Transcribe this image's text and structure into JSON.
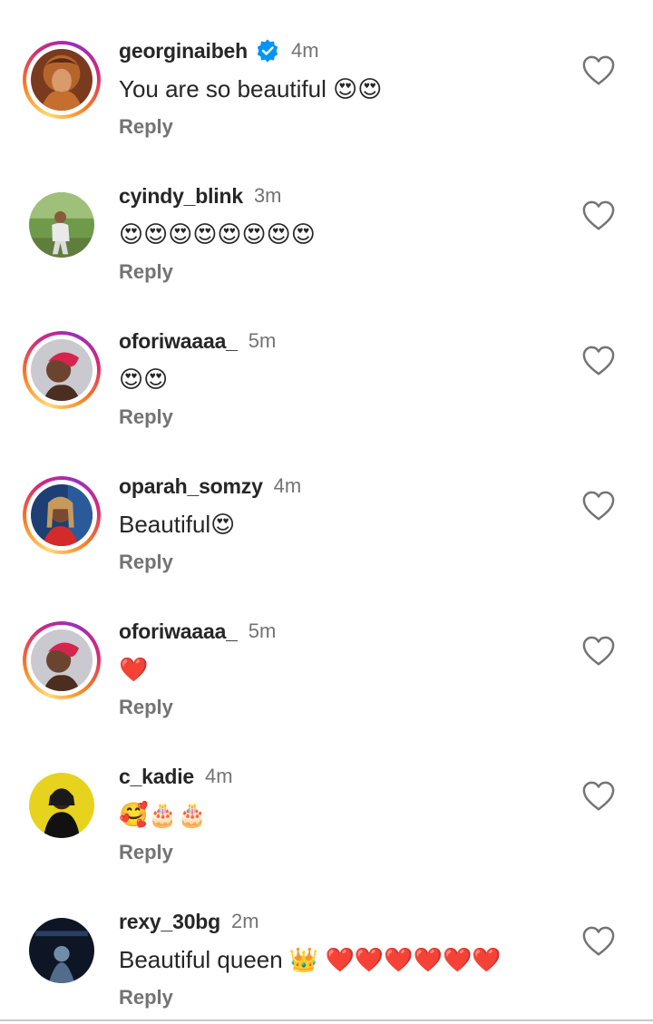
{
  "reply_label": "Reply",
  "colors": {
    "username": "#262626",
    "meta": "#737373",
    "verified": "#0095f6",
    "ring_gradient": [
      "#feda75",
      "#fa7e1e",
      "#d62976",
      "#962fbf"
    ]
  },
  "comments": [
    {
      "username": "georginaibeh",
      "verified": true,
      "time": "4m",
      "text": "You are so beautiful 😍😍",
      "story_ring": true,
      "liked": false
    },
    {
      "username": "cyindy_blink",
      "verified": false,
      "time": "3m",
      "text": "😍😍😍😍😍😍😍😍",
      "story_ring": false,
      "liked": false
    },
    {
      "username": "oforiwaaaa_",
      "verified": false,
      "time": "5m",
      "text": "😍😍",
      "story_ring": true,
      "liked": false
    },
    {
      "username": "oparah_somzy",
      "verified": false,
      "time": "4m",
      "text": "Beautiful😍",
      "story_ring": true,
      "liked": false
    },
    {
      "username": "oforiwaaaa_",
      "verified": false,
      "time": "5m",
      "text": "❤️",
      "story_ring": true,
      "liked": false
    },
    {
      "username": "c_kadie",
      "verified": false,
      "time": "4m",
      "text": "🥰🎂🎂",
      "story_ring": false,
      "liked": false
    },
    {
      "username": "rexy_30bg",
      "verified": false,
      "time": "2m",
      "text": "Beautiful queen 👑 ❤️❤️❤️❤️❤️❤️",
      "story_ring": false,
      "liked": false
    }
  ]
}
